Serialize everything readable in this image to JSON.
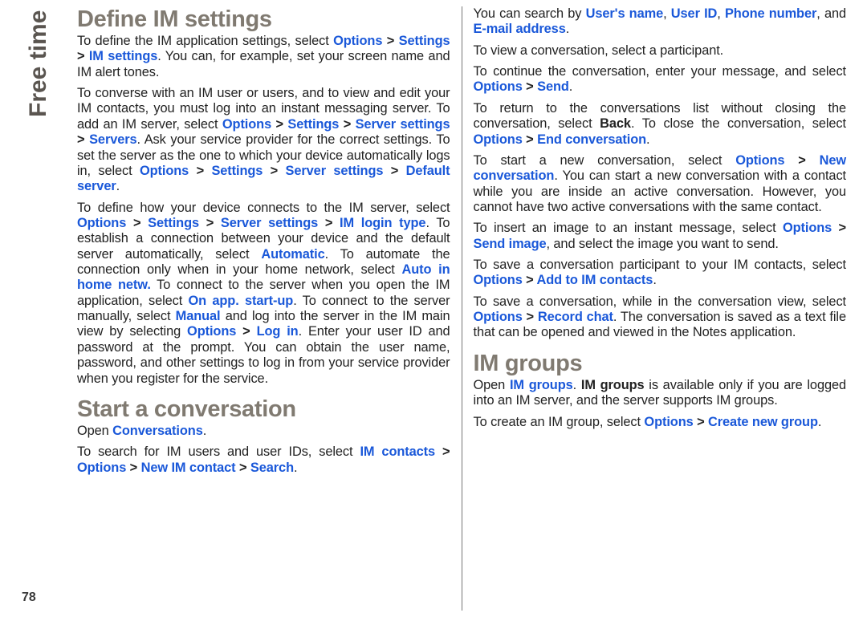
{
  "sideLabel": "Free time",
  "pageNumber": "78",
  "left": {
    "h1": "Define IM settings",
    "p1_a": "To define the IM application settings, select ",
    "p1_opt": "Options",
    "p1_gt1": " > ",
    "p1_set": "Settings",
    "p1_gt2": " > ",
    "p1_im": "IM settings",
    "p1_b": ". You can, for example, set your screen name and IM alert tones.",
    "p2_a": "To converse with an IM user or users, and to view and edit your IM contacts, you must log into an instant messaging server. To add an IM server, select ",
    "p2_opt": "Options",
    "p2_gt1": " > ",
    "p2_set": "Settings",
    "p2_gt2": " > ",
    "p2_srv": "Server settings",
    "p2_gt3": " > ",
    "p2_servers": "Servers",
    "p2_b": ". Ask your service provider for the correct settings. To set the server as the one to which your device automatically logs in, select ",
    "p2_opt2": "Options",
    "p2_gt4": " > ",
    "p2_set2": "Settings",
    "p2_gt5": " > ",
    "p2_srv2": "Server settings",
    "p2_gt6": " > ",
    "p2_def": "Default server",
    "p2_c": ".",
    "p3_a": "To define how your device connects to the IM server, select ",
    "p3_opt": "Options",
    "p3_gt1": " > ",
    "p3_set": "Settings",
    "p3_gt2": " > ",
    "p3_srv": "Server settings",
    "p3_gt3": " > ",
    "p3_login": "IM login type",
    "p3_b": ". To establish a connection between your device and the default server automatically, select ",
    "p3_auto": "Automatic",
    "p3_c": ". To automate the connection only when in your home network, select ",
    "p3_home": "Auto in home netw.",
    "p3_d": " To connect to the server when you open the IM application, select ",
    "p3_app": "On app. start-up",
    "p3_e": ". To connect to the server manually, select ",
    "p3_man": "Manual",
    "p3_f": " and log into the server in the IM main view by selecting ",
    "p3_opt2": "Options",
    "p3_gt4": " > ",
    "p3_login2": "Log in",
    "p3_g": ". Enter your user ID and password at the prompt. You can obtain the user name, password, and other settings to log in from your service provider when you register for the service.",
    "h2": "Start a conversation",
    "p4_a": "Open ",
    "p4_conv": "Conversations",
    "p4_b": ".",
    "p5_a": "To search for IM users and user IDs, select ",
    "p5_imc": "IM contacts",
    "p5_gt1": " > ",
    "p5_opt": "Options",
    "p5_gt2": " > ",
    "p5_new": "New IM contact",
    "p5_gt3": " > ",
    "p5_search": "Search",
    "p5_b": "."
  },
  "right": {
    "p1_a": "You can search by ",
    "p1_u1": "User's name",
    "p1_c1": ", ",
    "p1_u2": "User ID",
    "p1_c2": ", ",
    "p1_u3": "Phone number",
    "p1_c3": ", and ",
    "p1_u4": "E-mail address",
    "p1_b": ".",
    "p2": "To view a conversation, select a participant.",
    "p3_a": "To continue the conversation, enter your message, and select ",
    "p3_opt": "Options",
    "p3_gt": " > ",
    "p3_send": "Send",
    "p3_b": ".",
    "p4_a": "To return to the conversations list without closing the conversation, select ",
    "p4_back": "Back",
    "p4_b": ". To close the conversation, select ",
    "p4_opt": "Options",
    "p4_gt": " > ",
    "p4_end": "End conversation",
    "p4_c": ".",
    "p5_a": "To start a new conversation, select ",
    "p5_opt": "Options",
    "p5_gt": " > ",
    "p5_new": "New conversation",
    "p5_b": ". You can start a new conversation with a contact while you are inside an active conversation. However, you cannot have two active conversations with the same contact.",
    "p6_a": "To insert an image to an instant message, select ",
    "p6_opt": "Options",
    "p6_gt": " > ",
    "p6_img": "Send image",
    "p6_b": ", and select the image you want to send.",
    "p7_a": "To save a conversation participant to your IM contacts, select ",
    "p7_opt": "Options",
    "p7_gt": " > ",
    "p7_add": "Add to IM contacts",
    "p7_b": ".",
    "p8_a": "To save a conversation, while in the conversation view, select ",
    "p8_opt": "Options",
    "p8_gt": " > ",
    "p8_rec": "Record chat",
    "p8_b": ". The conversation is saved as a text file that can be opened and viewed in the Notes application.",
    "h1": "IM groups",
    "p9_a": "Open ",
    "p9_g": "IM groups",
    "p9_b": ". ",
    "p9_g2": "IM groups",
    "p9_c": " is available only if you are logged into an IM server, and the server supports IM groups.",
    "p10_a": "To create an IM group, select ",
    "p10_opt": "Options",
    "p10_gt": " > ",
    "p10_new": "Create new group",
    "p10_b": "."
  }
}
